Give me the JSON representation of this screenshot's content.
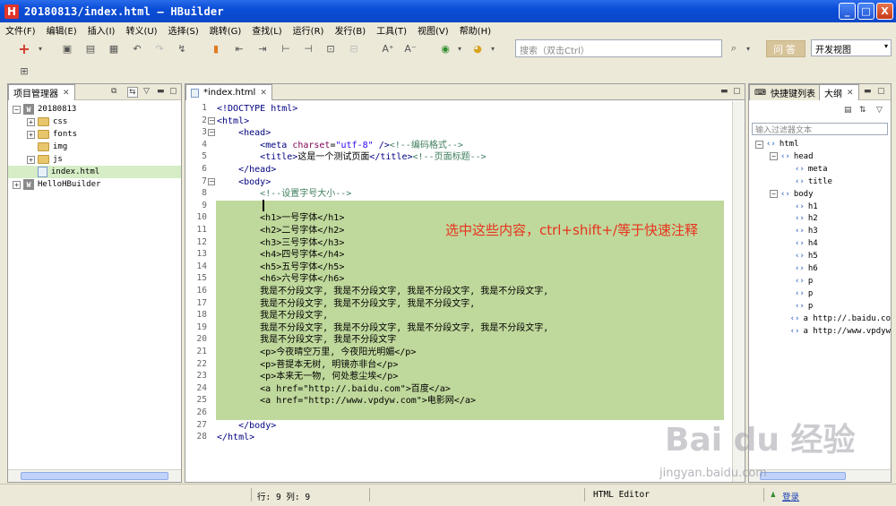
{
  "window": {
    "title": "20180813/index.html — HBuilder",
    "app_logo_letter": "H",
    "controls": {
      "minimize": "_",
      "maximize": "□",
      "close": "X"
    }
  },
  "menu": [
    "文件(F)",
    "编辑(E)",
    "插入(I)",
    "转义(U)",
    "选择(S)",
    "跳转(G)",
    "查找(L)",
    "运行(R)",
    "发行(B)",
    "工具(T)",
    "视图(V)",
    "帮助(H)"
  ],
  "toolbar": {
    "search_placeholder": "搜索（双击Ctrl）",
    "find_button": "问答",
    "view_select": "开发视图"
  },
  "project_panel": {
    "tab_label": "项目管理器",
    "tree": [
      {
        "label": "20180813",
        "kind": "project",
        "depth": 0,
        "expander": "−"
      },
      {
        "label": "css",
        "kind": "folder",
        "depth": 1,
        "expander": "+"
      },
      {
        "label": "fonts",
        "kind": "folder",
        "depth": 1,
        "expander": "+"
      },
      {
        "label": "img",
        "kind": "folder",
        "depth": 1,
        "expander": ""
      },
      {
        "label": "js",
        "kind": "folder",
        "depth": 1,
        "expander": "+"
      },
      {
        "label": "index.html",
        "kind": "file",
        "depth": 1,
        "expander": "",
        "selected": true
      },
      {
        "label": "HelloHBuilder",
        "kind": "project",
        "depth": 0,
        "expander": "+"
      }
    ]
  },
  "editor": {
    "tab_label": "*index.html",
    "selection_first_line": 9,
    "selection_last_line": 26,
    "lines": [
      {
        "n": "1",
        "fold": "",
        "html": "<span class='tag'>&lt;!DOCTYPE html&gt;</span>"
      },
      {
        "n": "2",
        "fold": "−",
        "html": "<span class='tag'>&lt;html&gt;</span>"
      },
      {
        "n": "3",
        "fold": "−",
        "html": "    <span class='tag'>&lt;head&gt;</span>"
      },
      {
        "n": "4",
        "fold": "",
        "html": "        <span class='tag'>&lt;meta</span> <span class='attr'>charset</span>=<span class='str'>\"utf-8\"</span> <span class='tag'>/&gt;</span><span class='cmt'>&lt;!--编码格式--&gt;</span>"
      },
      {
        "n": "5",
        "fold": "",
        "html": "        <span class='tag'>&lt;title&gt;</span>这是一个测试页面<span class='tag'>&lt;/title&gt;</span><span class='cmt'>&lt;!--页面标题--&gt;</span>"
      },
      {
        "n": "6",
        "fold": "",
        "html": "    <span class='tag'>&lt;/head&gt;</span>"
      },
      {
        "n": "7",
        "fold": "−",
        "html": "    <span class='tag'>&lt;body&gt;</span>"
      },
      {
        "n": "8",
        "fold": "",
        "html": "        <span class='cmt'>&lt;!--设置字号大小--&gt;</span>"
      },
      {
        "n": "9",
        "fold": "",
        "html": ""
      },
      {
        "n": "10",
        "fold": "",
        "html": "        &lt;h1&gt;一号字体&lt;/h1&gt;"
      },
      {
        "n": "11",
        "fold": "",
        "html": "        &lt;h2&gt;二号字体&lt;/h2&gt;"
      },
      {
        "n": "12",
        "fold": "",
        "html": "        &lt;h3&gt;三号字体&lt;/h3&gt;"
      },
      {
        "n": "13",
        "fold": "",
        "html": "        &lt;h4&gt;四号字体&lt;/h4&gt;"
      },
      {
        "n": "14",
        "fold": "",
        "html": "        &lt;h5&gt;五号字体&lt;/h5&gt;"
      },
      {
        "n": "15",
        "fold": "",
        "html": "        &lt;h6&gt;六号字体&lt;/h6&gt;"
      },
      {
        "n": "16",
        "fold": "",
        "html": "        我是不分段文字, 我是不分段文字, 我是不分段文字, 我是不分段文字,"
      },
      {
        "n": "17",
        "fold": "",
        "html": "        我是不分段文字, 我是不分段文字, 我是不分段文字,"
      },
      {
        "n": "18",
        "fold": "",
        "html": "        我是不分段文字,"
      },
      {
        "n": "19",
        "fold": "",
        "html": "        我是不分段文字, 我是不分段文字, 我是不分段文字, 我是不分段文字,"
      },
      {
        "n": "20",
        "fold": "",
        "html": "        我是不分段文字, 我是不分段文字"
      },
      {
        "n": "21",
        "fold": "",
        "html": "        &lt;p&gt;今夜晴空万里, 今夜阳光明媚&lt;/p&gt;"
      },
      {
        "n": "22",
        "fold": "",
        "html": "        &lt;p&gt;菩提本无树, 明镜亦非台&lt;/p&gt;"
      },
      {
        "n": "23",
        "fold": "",
        "html": "        &lt;p&gt;本来无一物, 何处惹尘埃&lt;/p&gt;"
      },
      {
        "n": "24",
        "fold": "",
        "html": "        &lt;a href=\"http://.baidu.com\"&gt;百度&lt;/a&gt;"
      },
      {
        "n": "25",
        "fold": "",
        "html": "        &lt;a href=\"http://www.vpdyw.com\"&gt;电影网&lt;/a&gt;"
      },
      {
        "n": "26",
        "fold": "",
        "html": ""
      },
      {
        "n": "27",
        "fold": "",
        "html": "    <span class='tag'>&lt;/body&gt;</span>"
      },
      {
        "n": "28",
        "fold": "",
        "html": "<span class='tag'>&lt;/html&gt;</span>"
      }
    ],
    "annotation": "选中这些内容，ctrl+shift+/等于快速注释"
  },
  "outline_panel": {
    "tab_shortcuts": "快捷键列表",
    "tab_outline": "大纲",
    "filter_placeholder": "输入过滤器文本",
    "tree": [
      {
        "label": "html",
        "depth": 0,
        "expander": "−"
      },
      {
        "label": "head",
        "depth": 1,
        "expander": "−"
      },
      {
        "label": "meta",
        "depth": 2,
        "expander": ""
      },
      {
        "label": "title",
        "depth": 2,
        "expander": ""
      },
      {
        "label": "body",
        "depth": 1,
        "expander": "−"
      },
      {
        "label": "h1",
        "depth": 2,
        "expander": ""
      },
      {
        "label": "h2",
        "depth": 2,
        "expander": ""
      },
      {
        "label": "h3",
        "depth": 2,
        "expander": ""
      },
      {
        "label": "h4",
        "depth": 2,
        "expander": ""
      },
      {
        "label": "h5",
        "depth": 2,
        "expander": ""
      },
      {
        "label": "h6",
        "depth": 2,
        "expander": ""
      },
      {
        "label": "p",
        "depth": 2,
        "expander": ""
      },
      {
        "label": "p",
        "depth": 2,
        "expander": ""
      },
      {
        "label": "p",
        "depth": 2,
        "expander": ""
      },
      {
        "label": "a http://.baidu.co",
        "depth": 2,
        "expander": ""
      },
      {
        "label": "a http://www.vpdyw",
        "depth": 2,
        "expander": ""
      }
    ]
  },
  "status": {
    "position": "行: 9 列: 9",
    "mode": "HTML Editor",
    "login": "登录"
  },
  "watermark": {
    "main": "Bai du 经验",
    "sub": "jingyan.baidu.com"
  }
}
